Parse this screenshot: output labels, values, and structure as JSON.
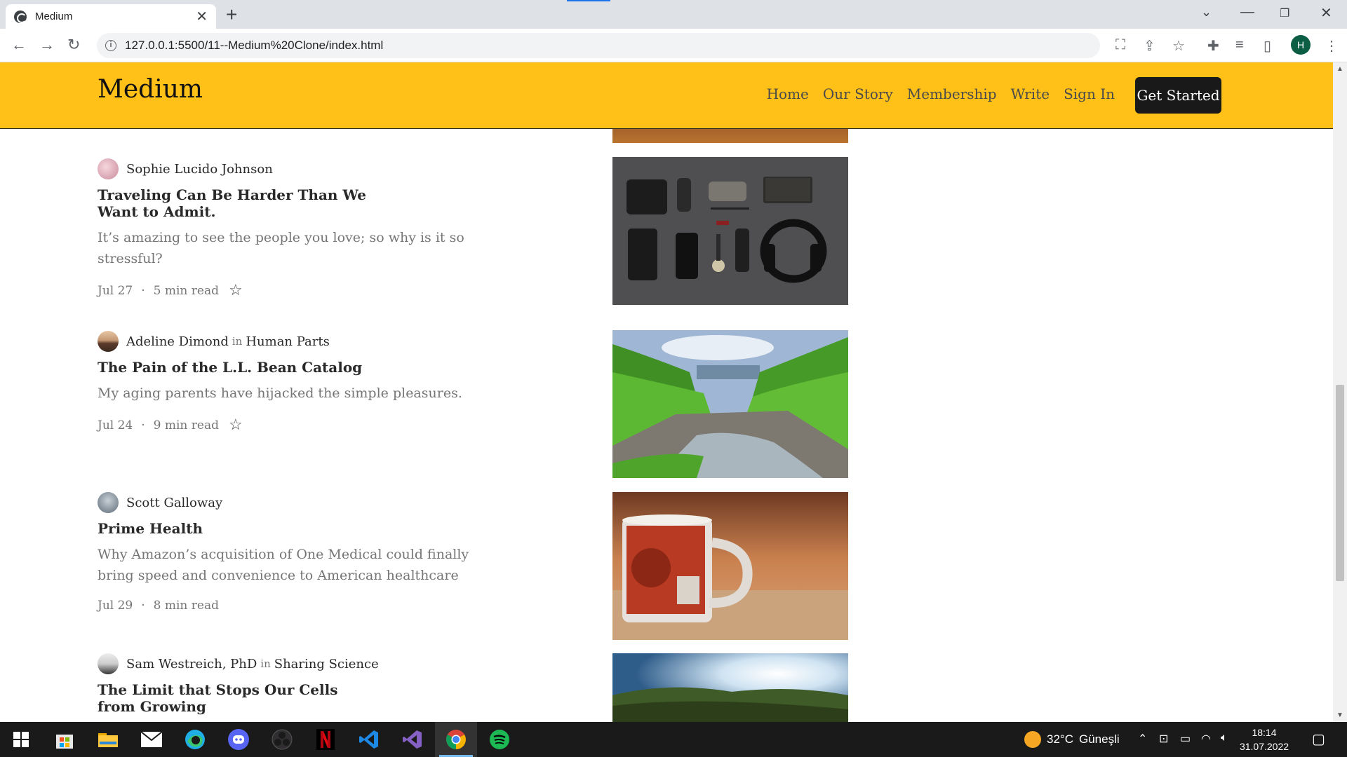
{
  "browser": {
    "tab_title": "Medium",
    "url": "127.0.0.1:5500/11--Medium%20Clone/index.html",
    "profile_initial": "H"
  },
  "site": {
    "logo": "Medium",
    "nav": [
      "Home",
      "Our Story",
      "Membership",
      "Write",
      "Sign In"
    ],
    "cta": "Get Started"
  },
  "articles": [
    {
      "author": "Sophie Lucido Johnson",
      "publication": "",
      "in_label": "",
      "title": "Traveling Can Be Harder Than We Want to Admit.",
      "excerpt": "It’s amazing to see the people you love; so why is it so stressful?",
      "date": "Jul 27",
      "read_time": "5 min read",
      "bookmark": true,
      "image": "flat-lay-accessories"
    },
    {
      "author": "Adeline Dimond",
      "publication": "Human Parts",
      "in_label": "in",
      "title": "The Pain of the L.L. Bean Catalog",
      "excerpt": "My aging parents have hijacked the simple pleasures.",
      "date": "Jul 24",
      "read_time": "9 min read",
      "bookmark": true,
      "image": "forest-river"
    },
    {
      "author": "Scott Galloway",
      "publication": "",
      "in_label": "",
      "title": "Prime Health",
      "excerpt": "Why Amazon’s acquisition of One Medical could finally bring speed and convenience to American healthcare",
      "date": "Jul 29",
      "read_time": "8 min read",
      "bookmark": false,
      "image": "red-mug"
    },
    {
      "author": "Sam Westreich, PhD",
      "publication": "Sharing Science",
      "in_label": "in",
      "title": "The Limit that Stops Our Cells from Growing",
      "excerpt": "",
      "date": "",
      "read_time": "",
      "bookmark": false,
      "image": "grass-sunlight"
    }
  ],
  "taskbar": {
    "weather_temp": "32°C",
    "weather_desc": "Güneşli",
    "time": "18:14",
    "date": "31.07.2022",
    "apps": [
      "windows-start",
      "microsoft-store",
      "file-explorer",
      "mail",
      "edge",
      "discord",
      "obs",
      "netflix",
      "vscode",
      "visual-studio",
      "chrome",
      "spotify"
    ]
  },
  "colors": {
    "brand_yellow": "#ffc017",
    "cta_bg": "#191919",
    "text_dark": "#292929",
    "text_muted": "#757575"
  }
}
